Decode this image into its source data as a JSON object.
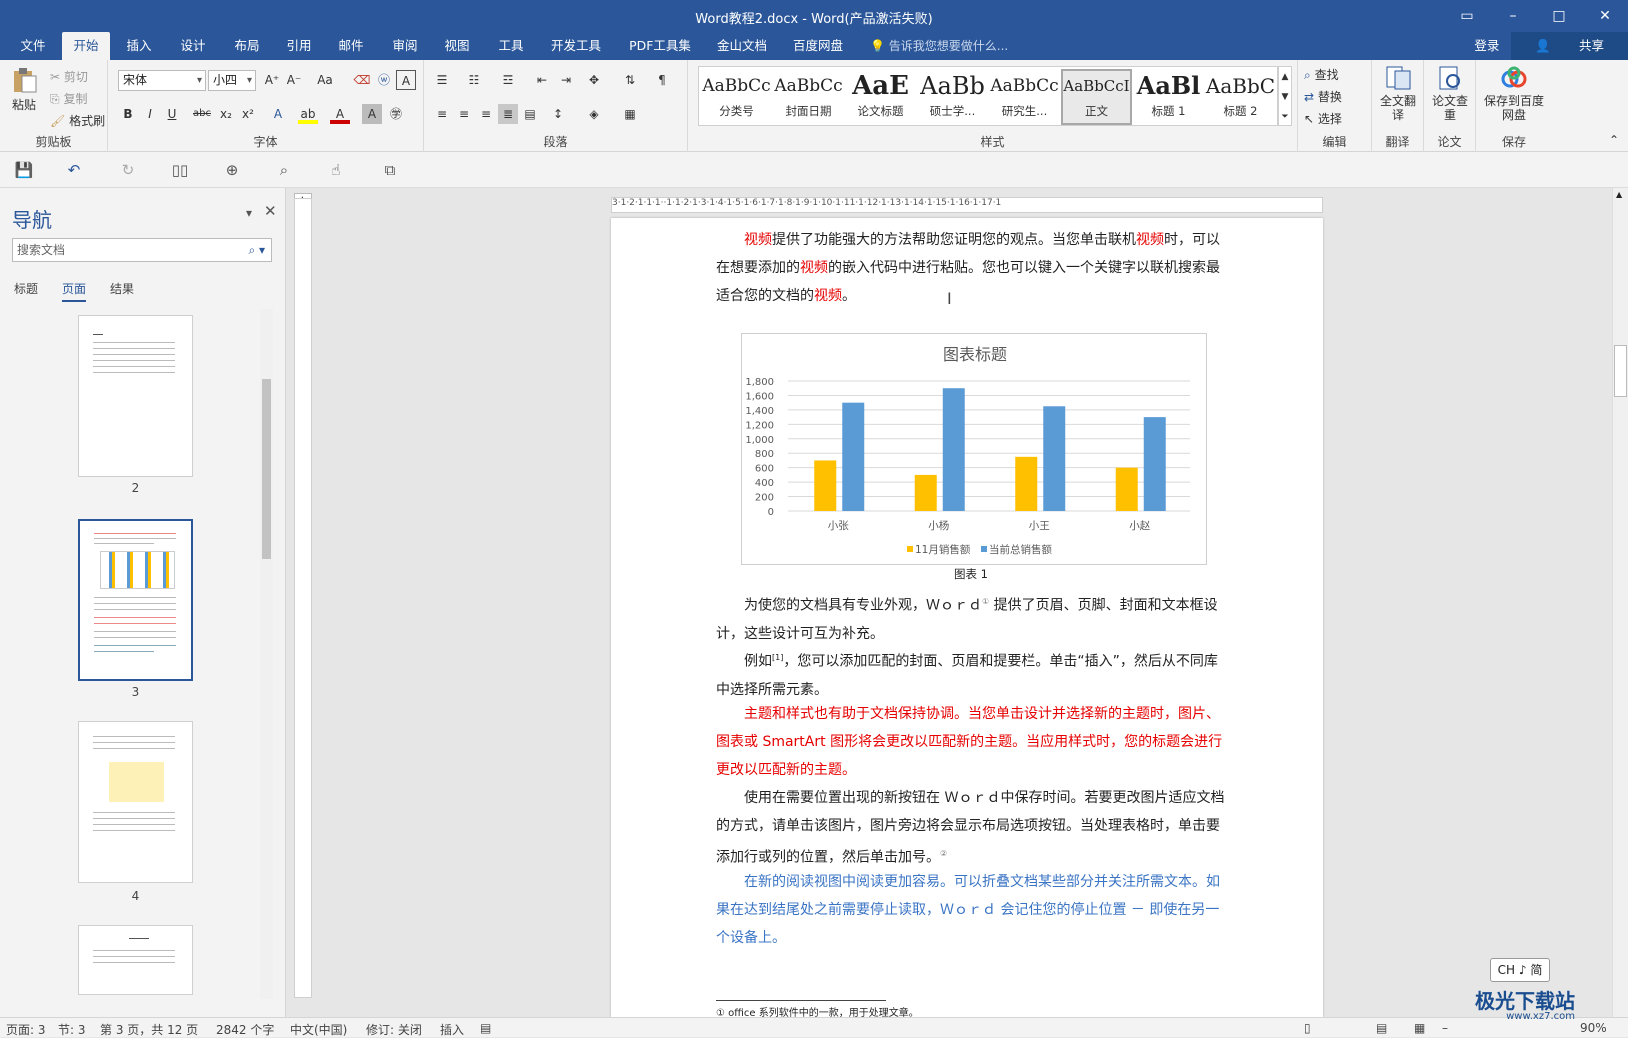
{
  "window": {
    "title": "Word教程2.docx - Word(产品激活失败)",
    "restore_icon": "▭",
    "minimize": "–",
    "maximize": "□",
    "close": "✕"
  },
  "tabs": [
    "文件",
    "开始",
    "插入",
    "设计",
    "布局",
    "引用",
    "邮件",
    "审阅",
    "视图",
    "工具",
    "开发工具",
    "PDF工具集",
    "金山文档",
    "百度网盘"
  ],
  "tellme": "告诉我您想要做什么...",
  "account": {
    "login": "登录",
    "share": "共享"
  },
  "ribbon": {
    "clipboard": {
      "paste": "粘贴",
      "cut": "剪切",
      "copy": "复制",
      "format_painter": "格式刷",
      "label": "剪贴板"
    },
    "font": {
      "name": "宋体",
      "size": "小四",
      "label": "字体",
      "aa": "Aa"
    },
    "paragraph": {
      "label": "段落"
    },
    "styles": {
      "label": "样式",
      "items": [
        {
          "sample": "AaBbCc",
          "name": "分类号"
        },
        {
          "sample": "AaBbCc",
          "name": "封面日期"
        },
        {
          "sample": "AaE",
          "name": "论文标题"
        },
        {
          "sample": "AaBb",
          "name": "硕士学..."
        },
        {
          "sample": "AaBbCc",
          "name": "研究生..."
        },
        {
          "sample": "AaBbCcI",
          "name": "正文"
        },
        {
          "sample": "AaBl",
          "name": "标题 1"
        },
        {
          "sample": "AaBbC",
          "name": "标题 2"
        }
      ]
    },
    "editing": {
      "find": "查找",
      "replace": "替换",
      "select": "选择",
      "label": "编辑"
    },
    "translate": {
      "full": "全文翻译",
      "label": "翻译"
    },
    "paper": {
      "check": "论文查重",
      "label": "论文"
    },
    "save": {
      "baidu": "保存到百度网盘",
      "label": "保存"
    }
  },
  "nav": {
    "title": "导航",
    "search_placeholder": "搜索文档",
    "tabs": [
      "标题",
      "页面",
      "结果"
    ],
    "pages": [
      "2",
      "3",
      "4"
    ]
  },
  "doc": {
    "p1_parts": [
      "视频",
      "提供了功能强大的方法帮助您证明您的观点。当您单击联机",
      "视频",
      "时，可以在想要添加的",
      "视频",
      "的嵌入代码中进行粘贴。您也可以键入一个关键字以联机搜索最适合您的文档的",
      "视频",
      "。"
    ],
    "caption": "图表 1",
    "p2": "为使您的文档具有专业外观，Ｗｏｒｄ",
    "p2_note": "①",
    "p2_tail": " 提供了页眉、页脚、封面和文本框设计，这些设计可互为补充。",
    "p3a": "例如",
    "p3_ref": "[1]",
    "p3b": "，您可以添加匹配的封面、页眉和提要栏。单击“插入”，然后从不同库中选择所需元素。",
    "p4": "主题和样式也有助于文档保持协调。当您单击设计并选择新的主题时，图片、图表或 SmartArt 图形将会更改以匹配新的主题。当应用样式时，您的标题会进行更改以匹配新的主题。",
    "p5": "使用在需要位置出现的新按钮在 Ｗｏｒｄ中保存时间。若要更改图片适应文档的方式，请单击该图片，图片旁边将会显示布局选项按钮。当处理表格时，单击要添加行或列的位置，然后单击加号。",
    "p5_note": "②",
    "p6": "在新的阅读视图中阅读更加容易。可以折叠文档某些部分并关注所需文本。如果在达到结尾处之前需要停止读取，Ｗｏｒｄ 会记住您的停止位置 － 即使在另一个设备上。",
    "footnote": "① office 系列软件中的一款，用于处理文章。"
  },
  "chart_data": {
    "type": "bar",
    "title": "图表标题",
    "categories": [
      "小张",
      "小杨",
      "小王",
      "小赵"
    ],
    "series": [
      {
        "name": "11月销售额",
        "values": [
          700,
          500,
          750,
          600
        ],
        "color": "#ffc000"
      },
      {
        "name": "当前总销售额",
        "values": [
          1500,
          1700,
          1450,
          1300
        ],
        "color": "#5b9bd5"
      }
    ],
    "ylim": [
      0,
      1800
    ],
    "yticks": [
      "0",
      "200",
      "400",
      "600",
      "800",
      "1,000",
      "1,200",
      "1,400",
      "1,600",
      "1,800"
    ],
    "grid": true,
    "legend": "bottom"
  },
  "ime": "CH ♪ 简",
  "status": {
    "page": "页面: 3",
    "section": "节: 3",
    "pages": "第 3 页，共 12 页",
    "words": "2842 个字",
    "lang": "中文(中国)",
    "track": "修订: 关闭",
    "mode": "插入",
    "zoom": "90%"
  },
  "watermark": {
    "text": "极光下载站",
    "url": "www.xz7.com"
  }
}
